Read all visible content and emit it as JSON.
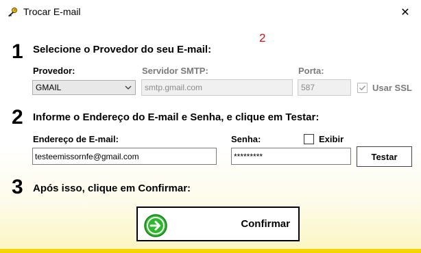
{
  "window": {
    "title": "Trocar E-mail",
    "close_glyph": "✕"
  },
  "marker": "2",
  "step1": {
    "number": "1",
    "title": "Selecione o Provedor do seu E-mail:",
    "provider_label": "Provedor:",
    "provider_value": "GMAIL",
    "smtp_label": "Servidor SMTP:",
    "smtp_value": "smtp.gmail.com",
    "port_label": "Porta:",
    "port_value": "587",
    "ssl_label": "Usar SSL",
    "ssl_checked": true
  },
  "step2": {
    "number": "2",
    "title": "Informe o Endereço do E-mail e Senha, e clique em Testar:",
    "email_label": "Endereço de E-mail:",
    "email_value": "testeemissornfe@gmail.com",
    "password_label": "Senha:",
    "password_value": "*********",
    "show_label": "Exibir",
    "show_checked": false,
    "test_button": "Testar"
  },
  "step3": {
    "number": "3",
    "title": "Após isso, clique em Confirmar:",
    "confirm_button": "Confirmar"
  },
  "colors": {
    "accent_yellow": "#f5d400",
    "confirm_green": "#2eb82e",
    "marker_red": "#d01010"
  },
  "icons": {
    "app": "key-icon",
    "close": "close-icon",
    "dropdown": "chevron-down-icon",
    "confirm": "arrow-right-circle-icon",
    "check": "checkmark-icon"
  }
}
